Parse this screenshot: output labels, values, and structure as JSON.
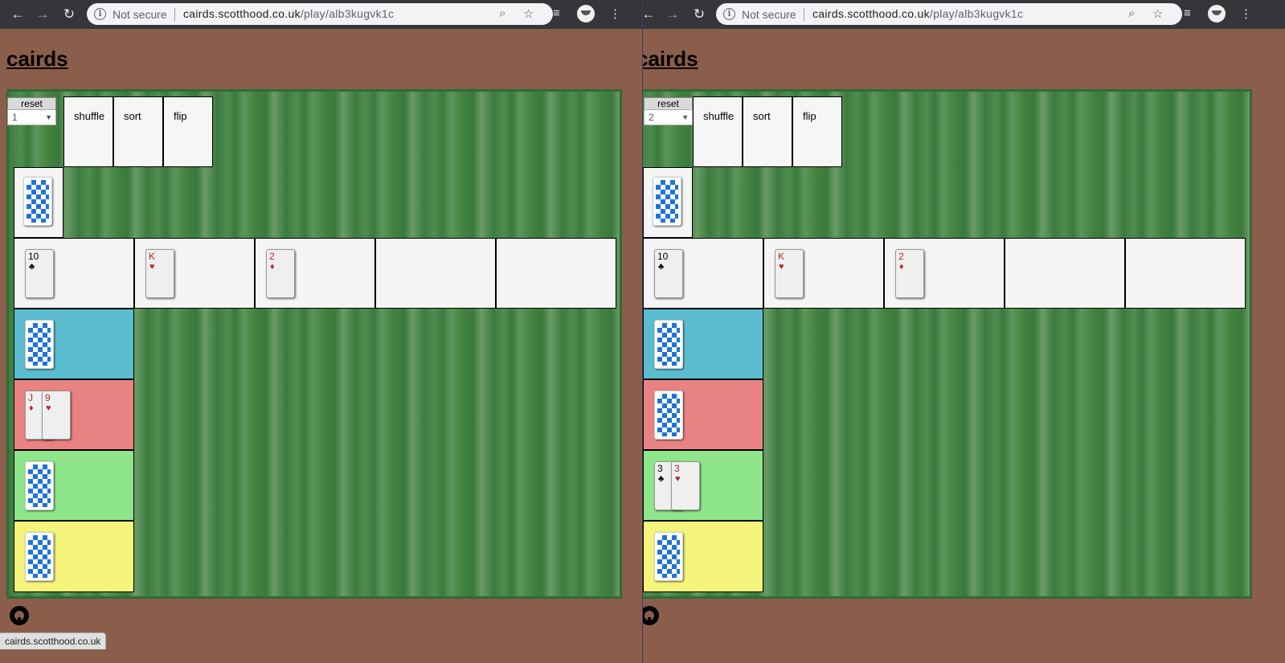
{
  "browser": {
    "not_secure": "Not secure",
    "url_host": "cairds.scotthood.co.uk",
    "url_path": "/play/alb3kugvk1c"
  },
  "page": {
    "title": "cairds",
    "reset_label": "reset",
    "buttons": {
      "shuffle": "shuffle",
      "sort": "sort",
      "flip": "flip"
    },
    "status_text": "cairds.scotthood.co.uk"
  },
  "zone_colors": {
    "blue": "#5bbcd0",
    "red": "#e98383",
    "green": "#8ee58a",
    "yellow": "#f4f57a"
  },
  "left": {
    "player_select": "1",
    "pile_cards": [
      {
        "rank": "10",
        "suit": "♣",
        "color": "black"
      },
      {
        "rank": "K",
        "suit": "♥",
        "color": "red"
      },
      {
        "rank": "2",
        "suit": "♦",
        "color": "red"
      }
    ],
    "red_hand": [
      {
        "rank": "J",
        "suit": "♦",
        "color": "red"
      },
      {
        "rank": "9",
        "suit": "♥",
        "color": "red"
      }
    ]
  },
  "right": {
    "player_select": "2",
    "pile_cards": [
      {
        "rank": "10",
        "suit": "♣",
        "color": "black"
      },
      {
        "rank": "K",
        "suit": "♥",
        "color": "red"
      },
      {
        "rank": "2",
        "suit": "♦",
        "color": "red"
      }
    ],
    "green_hand": [
      {
        "rank": "3",
        "suit": "♣",
        "color": "black"
      },
      {
        "rank": "3",
        "suit": "♥",
        "color": "red"
      }
    ]
  }
}
